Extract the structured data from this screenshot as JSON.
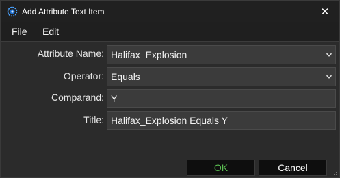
{
  "window": {
    "title": "Add Attribute Text Item",
    "icon": "app-gear-icon",
    "close_glyph": "✕"
  },
  "menu": {
    "file": "File",
    "edit": "Edit"
  },
  "form": {
    "attribute_name_label": "Attribute Name:",
    "attribute_name_value": "Halifax_Explosion",
    "operator_label": "Operator:",
    "operator_value": "Equals",
    "comparand_label": "Comparand:",
    "comparand_value": "Y",
    "title_label": "Title:",
    "title_value": "Halifax_Explosion Equals Y"
  },
  "buttons": {
    "ok": "OK",
    "cancel": "Cancel"
  },
  "colors": {
    "ok_text": "#5bbf52",
    "background": "#2b2b2b",
    "field": "#3b3b3b"
  }
}
